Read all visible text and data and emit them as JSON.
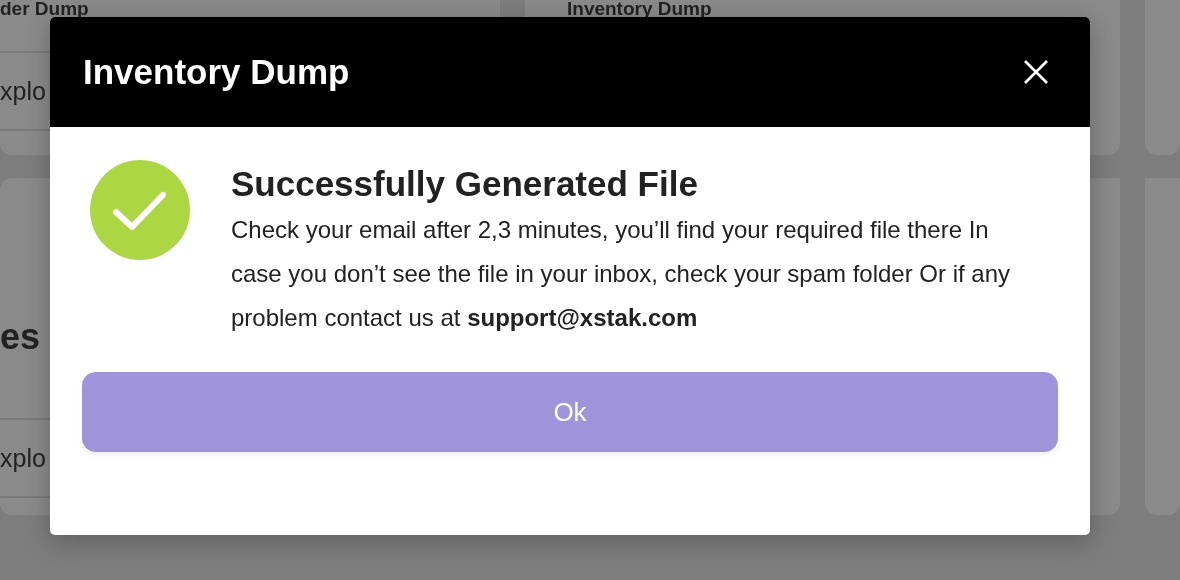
{
  "background": {
    "cards": [
      {
        "title": "der Dump",
        "button": "xplo"
      },
      {
        "title": "Inventory Dump"
      },
      {
        "title": "es",
        "button": "xplo"
      }
    ]
  },
  "dialog": {
    "title": "Inventory Dump",
    "heading": "Successfully Generated File",
    "message": "Check your email after 2,3 minutes, you’ll find your required file there In case you don’t see the file in your inbox, check your spam folder Or if any problem contact us at **support@xstak.com**",
    "button": "Ok"
  }
}
